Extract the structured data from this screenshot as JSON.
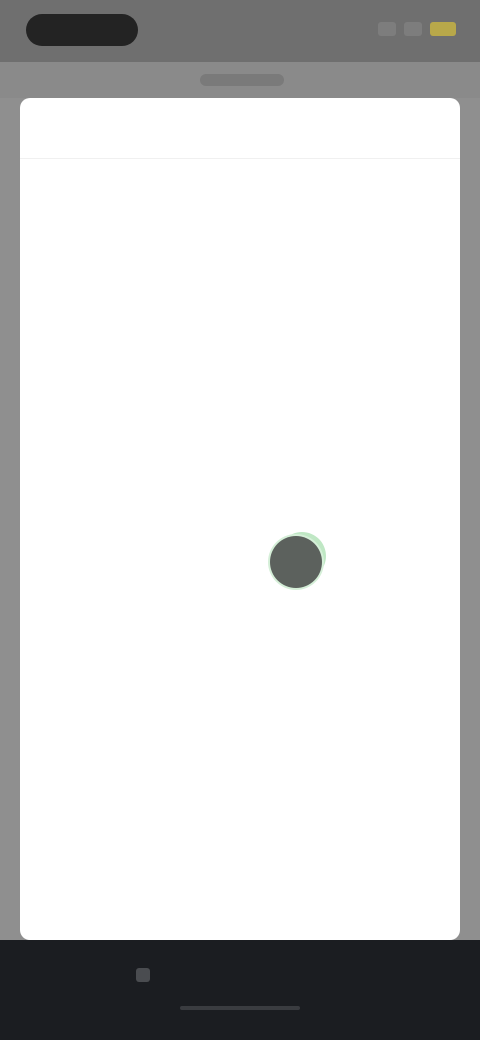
{
  "status_bar": {
    "time": "",
    "icons": [
      "signal-icon",
      "wifi-icon",
      "battery-icon"
    ]
  },
  "sheet": {
    "cancel_label": "",
    "title": "",
    "weekdays": [
      "",
      "",
      "",
      "",
      "",
      "",
      ""
    ],
    "month_label": "",
    "days": [
      "",
      "",
      "",
      "",
      "",
      "",
      "",
      "",
      "",
      "",
      "",
      "",
      "",
      "",
      "",
      "",
      "",
      "",
      "",
      "",
      "",
      "",
      "",
      "",
      "",
      "",
      "",
      "",
      "",
      "",
      "",
      "",
      "",
      "",
      "",
      "",
      "",
      "",
      "",
      "",
      "",
      ""
    ],
    "selected_index": 32
  },
  "colors": {
    "selected_day": "#5c615d",
    "selected_ring": "#d5efd8",
    "battery": "#b8a84a",
    "nav_bar": "#1b1d21"
  }
}
